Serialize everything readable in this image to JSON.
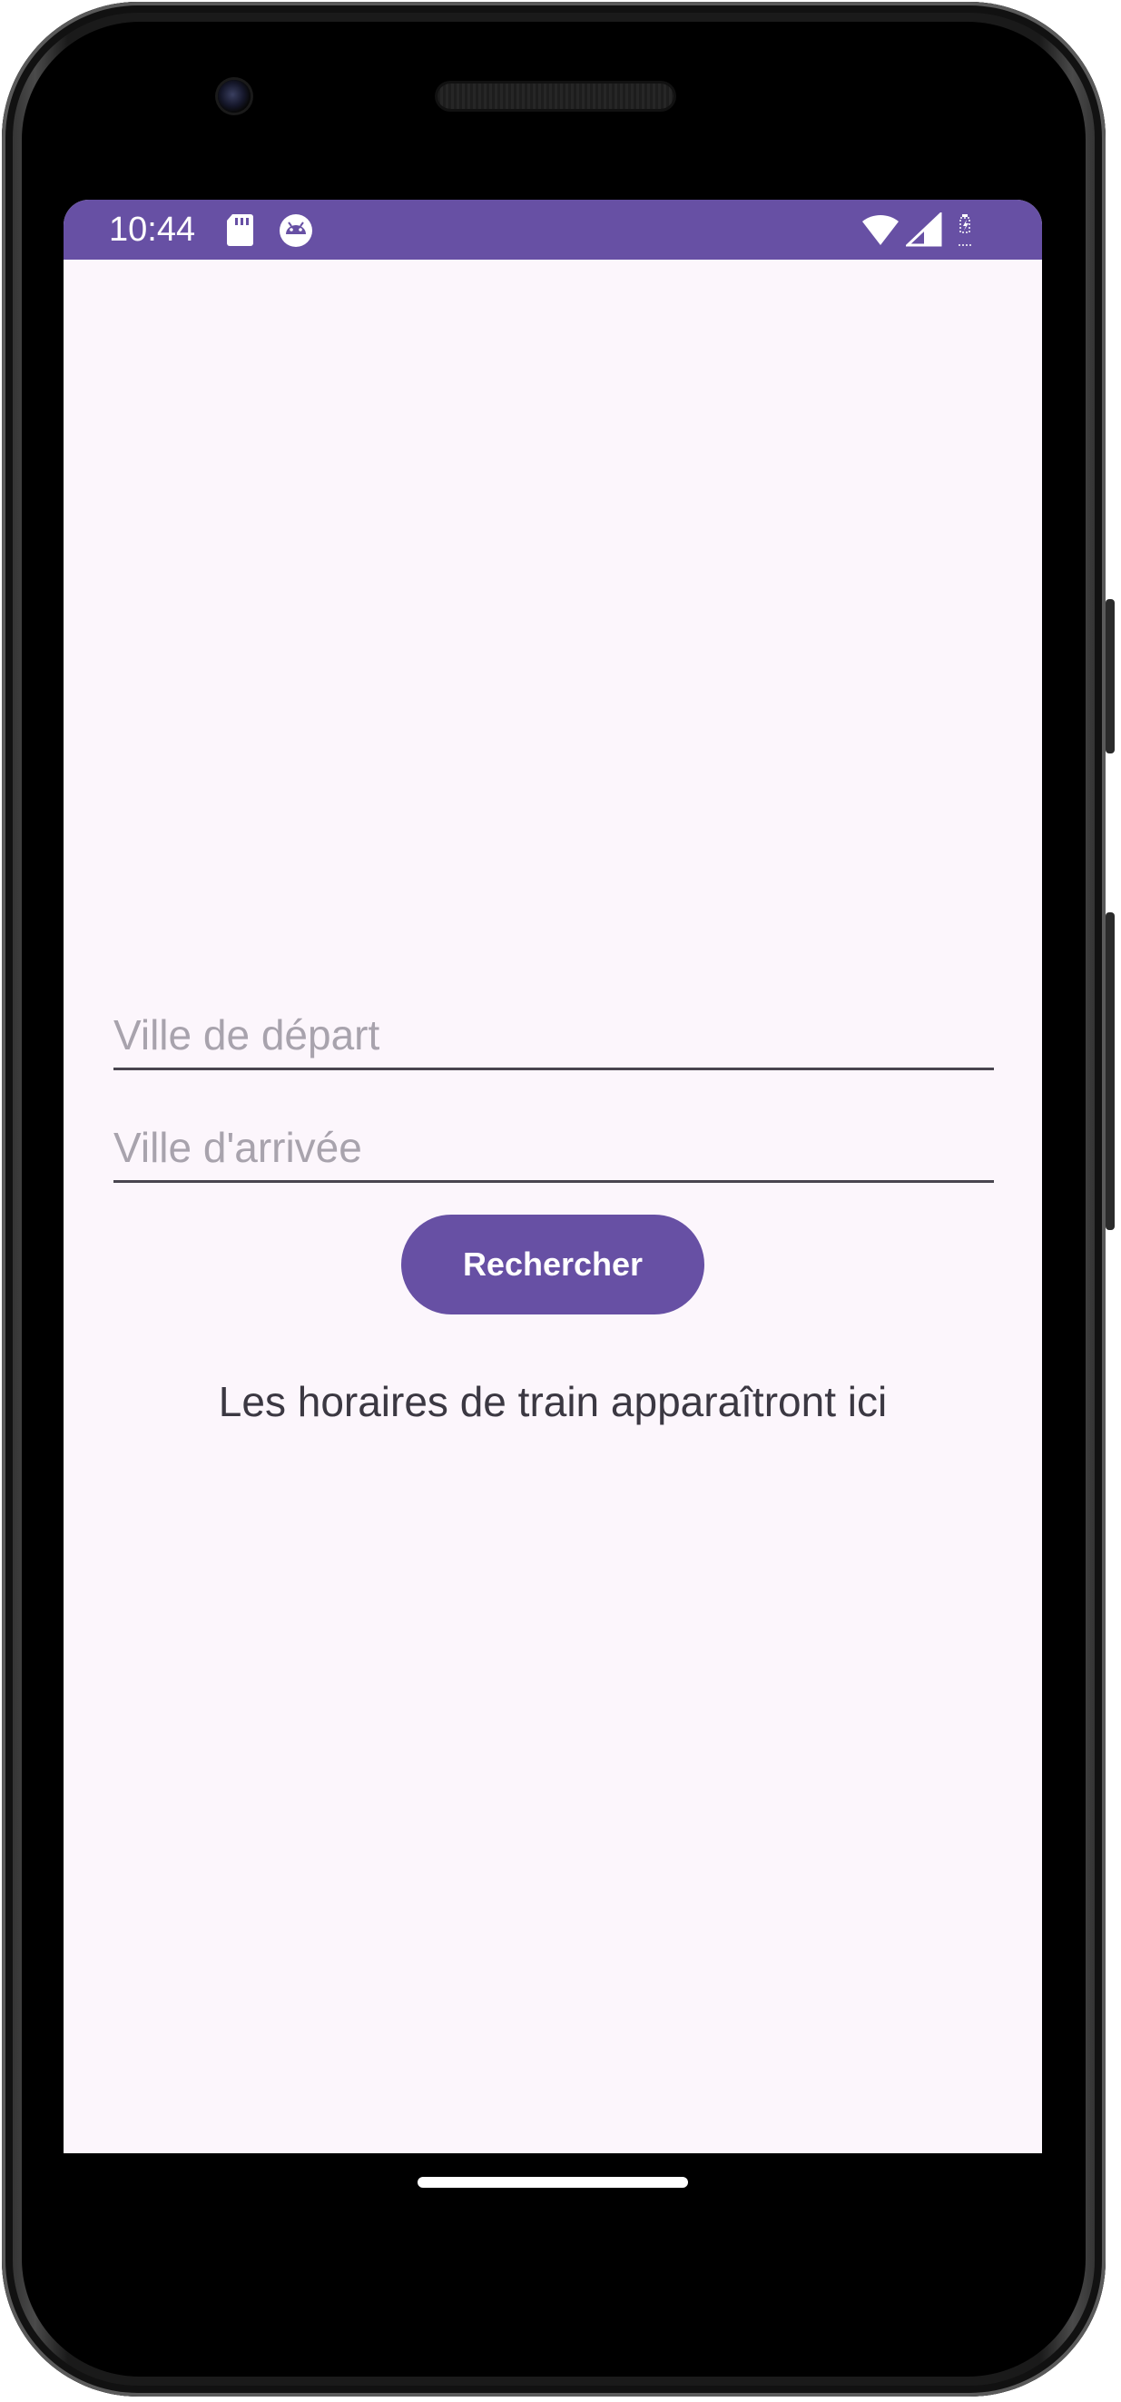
{
  "status_bar": {
    "time": "10:44",
    "icons": [
      "sd-card-icon",
      "android-icon",
      "wifi-icon",
      "signal-icon",
      "battery-icon"
    ],
    "color": "#6750a4"
  },
  "form": {
    "departure_placeholder": "Ville de départ",
    "departure_value": "",
    "arrival_placeholder": "Ville d'arrivée",
    "arrival_value": "",
    "search_button_label": "Rechercher",
    "results_text": "Les horaires de train apparaîtront ici"
  },
  "theme": {
    "accent": "#6750a4",
    "background": "#fcf6fc",
    "placeholder": "#a8a3ad"
  }
}
